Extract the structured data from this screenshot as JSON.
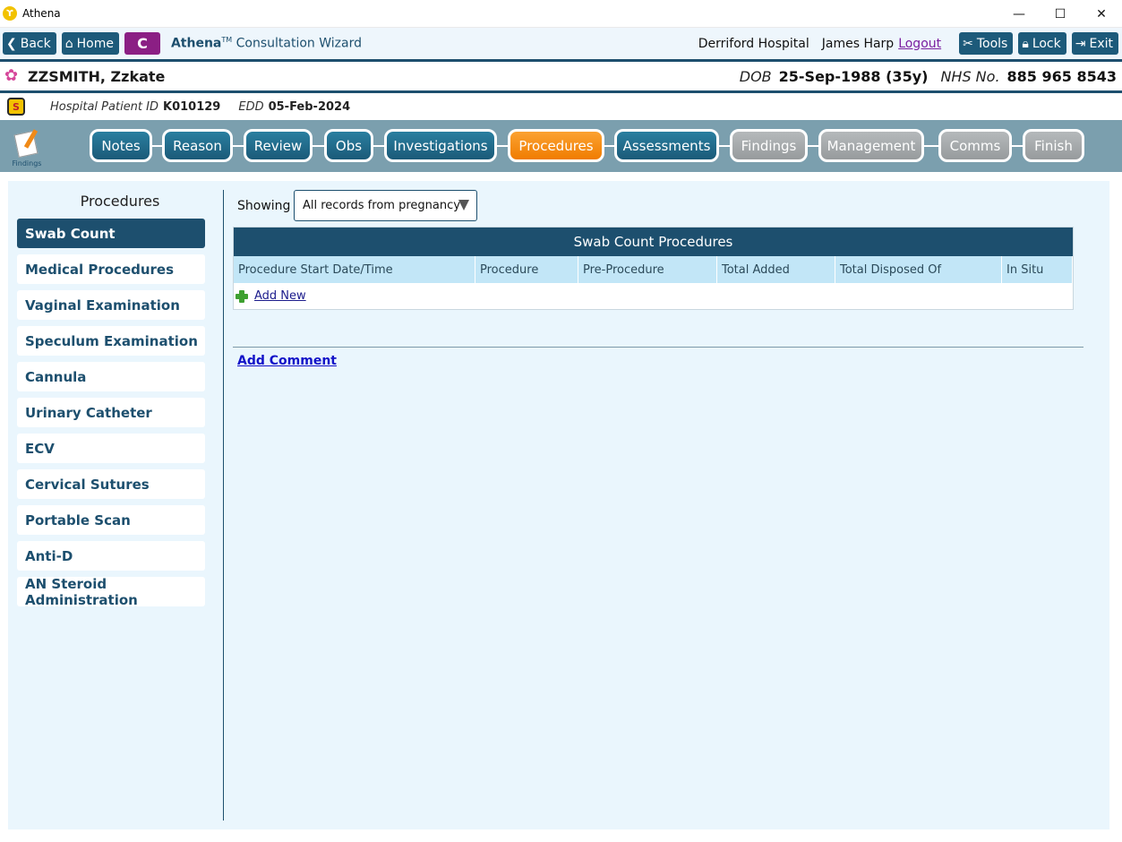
{
  "window": {
    "title": "Athena",
    "controls": {
      "minimize": "—",
      "maximize": "☐",
      "close": "✕"
    }
  },
  "toolbar": {
    "back_label": "Back",
    "home_label": "Home",
    "c_label": "C",
    "wizard_brand": "Athena",
    "wizard_tm": "TM",
    "wizard_title": " Consultation Wizard",
    "hospital": "Derriford Hospital",
    "user": "James Harp",
    "logout_label": "Logout",
    "tools_label": "Tools",
    "lock_label": "Lock",
    "exit_label": "Exit"
  },
  "patient": {
    "name": "ZZSMITH, Zzkate",
    "dob_label": "DOB",
    "dob_value": "25-Sep-1988 (35y)",
    "nhs_label": "NHS No.",
    "nhs_value": "885 965 8543",
    "hospital_id_label": "Hospital Patient ID",
    "hospital_id_value": "K010129",
    "edd_label": "EDD",
    "edd_value": "05-Feb-2024"
  },
  "steps": {
    "findings_icon_caption": "Findings",
    "items": [
      {
        "label": "Notes",
        "state": "normal"
      },
      {
        "label": "Reason",
        "state": "normal"
      },
      {
        "label": "Review",
        "state": "normal"
      },
      {
        "label": "Obs",
        "state": "normal"
      },
      {
        "label": "Investigations",
        "state": "normal"
      },
      {
        "label": "Procedures",
        "state": "active"
      },
      {
        "label": "Assessments",
        "state": "normal"
      },
      {
        "label": "Findings",
        "state": "disabled"
      },
      {
        "label": "Management",
        "state": "disabled"
      },
      {
        "label": "Comms",
        "state": "disabled"
      },
      {
        "label": "Finish",
        "state": "disabled"
      }
    ]
  },
  "sidebar": {
    "title": "Procedures",
    "items": [
      {
        "label": "Swab Count",
        "selected": true
      },
      {
        "label": "Medical Procedures",
        "selected": false
      },
      {
        "label": "Vaginal Examination",
        "selected": false
      },
      {
        "label": "Speculum Examination",
        "selected": false
      },
      {
        "label": "Cannula",
        "selected": false
      },
      {
        "label": "Urinary Catheter",
        "selected": false
      },
      {
        "label": "ECV",
        "selected": false
      },
      {
        "label": "Cervical Sutures",
        "selected": false
      },
      {
        "label": "Portable Scan",
        "selected": false
      },
      {
        "label": "Anti-D",
        "selected": false
      },
      {
        "label": "AN Steroid Administration",
        "selected": false
      }
    ]
  },
  "filter": {
    "label": "Showing",
    "selected": "All records from pregnancy"
  },
  "table": {
    "title": "Swab Count Procedures",
    "columns": [
      "Procedure Start Date/Time",
      "Procedure",
      "Pre-Procedure",
      "Total Added",
      "Total Disposed Of",
      "In Situ"
    ],
    "add_new_label": "Add New"
  },
  "comment": {
    "add_label": "Add Comment"
  },
  "colors": {
    "primary": "#1d4f6e",
    "active_step": "#f07c00",
    "disabled_step": "#979b9d",
    "stepbar_bg": "#7b9fae",
    "panel_bg": "#eaf6fd",
    "header_row": "#c2e6f7",
    "c_button": "#8b1f84"
  }
}
